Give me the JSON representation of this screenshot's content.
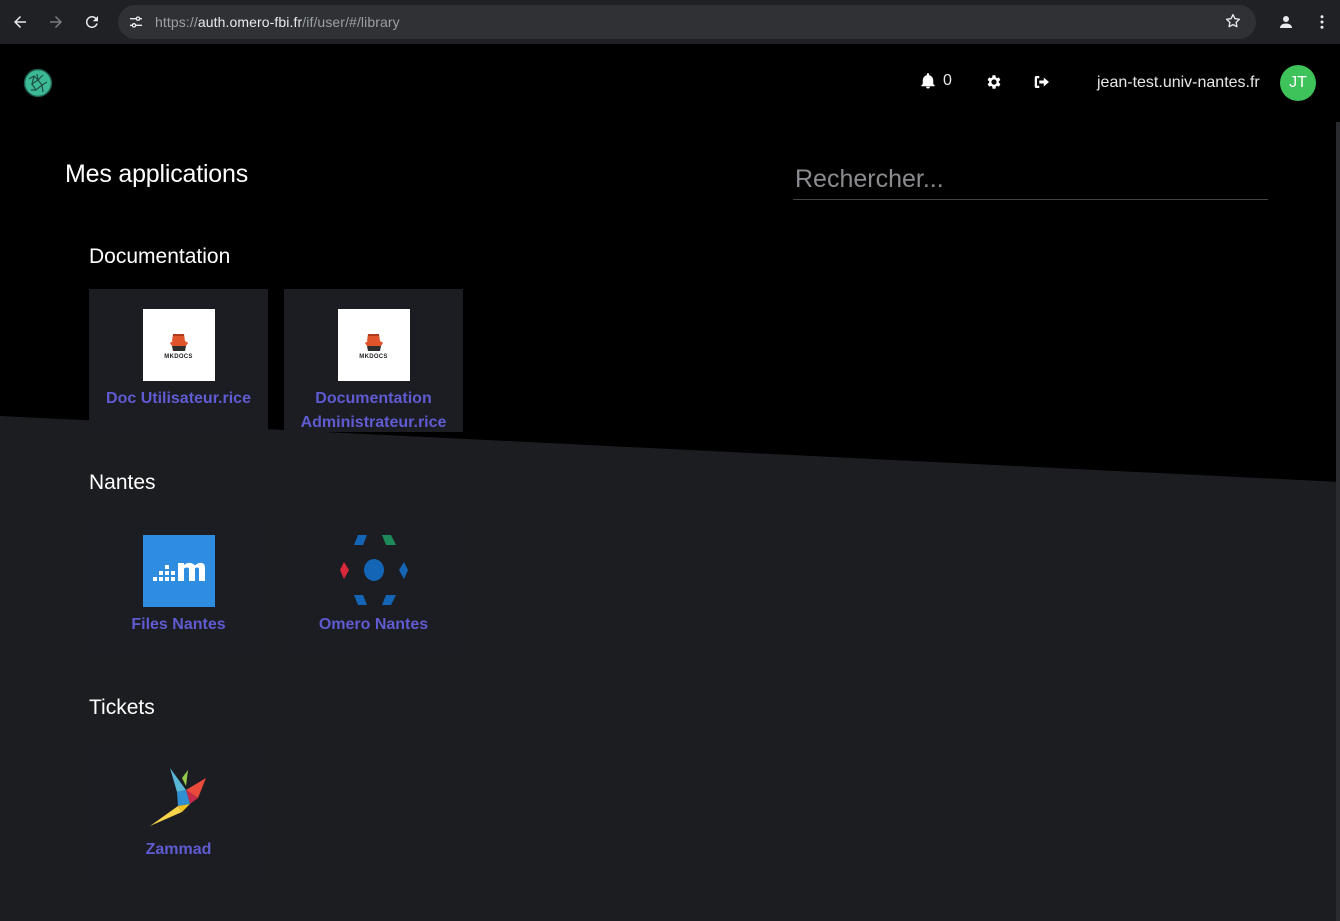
{
  "browser": {
    "url_scheme": "https://",
    "url_host": "auth.omero-fbi.fr",
    "url_path": "/if/user/#/library"
  },
  "header": {
    "notification_count": "0",
    "username": "jean-test.univ-nantes.fr",
    "avatar_initials": "JT"
  },
  "main": {
    "title": "Mes applications",
    "search_placeholder": "Rechercher..."
  },
  "groups": [
    {
      "title": "Documentation",
      "apps": [
        {
          "label": "Doc Utilisateur.rice",
          "icon": "mkdocs-icon"
        },
        {
          "label": "Documentation Administrateur.rice",
          "icon": "mkdocs-icon"
        }
      ]
    },
    {
      "title": "Nantes",
      "apps": [
        {
          "label": "Files Nantes",
          "icon": "files-icon"
        },
        {
          "label": "Omero Nantes",
          "icon": "omero-icon"
        }
      ]
    },
    {
      "title": "Tickets",
      "apps": [
        {
          "label": "Zammad",
          "icon": "zammad-icon"
        }
      ]
    }
  ],
  "icon_text": {
    "mkdocs": "MKDOCS"
  },
  "colors": {
    "accent_link": "#5f5bd1",
    "avatar": "#3ec25a",
    "card_bg": "#1c1d22",
    "page_bg": "#000000",
    "slant_bg": "#1c1d21"
  }
}
